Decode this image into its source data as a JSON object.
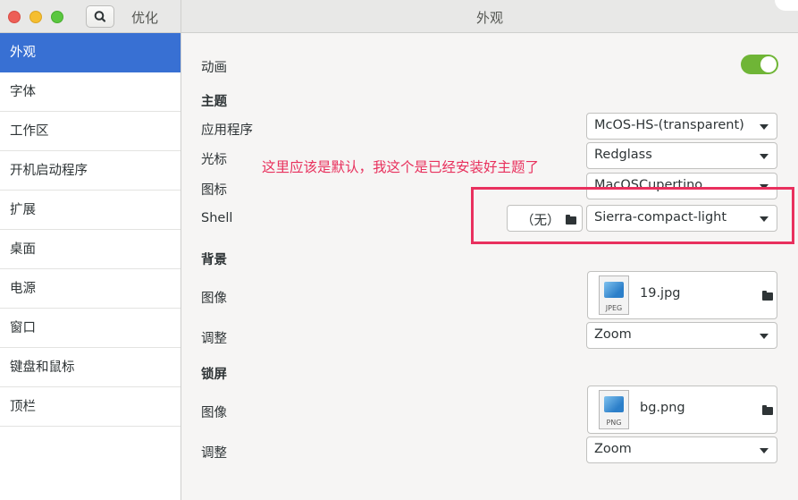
{
  "window": {
    "app_title": "优化",
    "page_title": "外观"
  },
  "sidebar": {
    "items": [
      {
        "label": "外观",
        "selected": true
      },
      {
        "label": "字体"
      },
      {
        "label": "工作区"
      },
      {
        "label": "开机启动程序"
      },
      {
        "label": "扩展"
      },
      {
        "label": "桌面"
      },
      {
        "label": "电源"
      },
      {
        "label": "窗口"
      },
      {
        "label": "键盘和鼠标"
      },
      {
        "label": "顶栏"
      }
    ]
  },
  "main": {
    "animation": {
      "label": "动画",
      "enabled": true
    },
    "themes": {
      "header": "主题",
      "applications": {
        "label": "应用程序",
        "value": "McOS-HS-(transparent)"
      },
      "cursor": {
        "label": "光标",
        "value": "Redglass"
      },
      "icons": {
        "label": "图标",
        "value": "MacOSCupertino"
      },
      "shell": {
        "label": "Shell",
        "file_value": "（无）",
        "value": "Sierra-compact-light"
      }
    },
    "background": {
      "header": "背景",
      "image": {
        "label": "图像",
        "filename": "19.jpg",
        "format": "JPEG"
      },
      "adjust": {
        "label": "调整",
        "value": "Zoom"
      }
    },
    "lockscreen": {
      "header": "锁屏",
      "image": {
        "label": "图像",
        "filename": "bg.png",
        "format": "PNG"
      },
      "adjust": {
        "label": "调整",
        "value": "Zoom"
      }
    }
  },
  "annotation": {
    "text": "这里应该是默认，我这个是已经安装好主题了",
    "color": "#e9305e"
  },
  "colors": {
    "selection": "#3870d3",
    "toggle_on": "#6fb536"
  },
  "icons": [
    "search-icon",
    "folder-icon",
    "chevron-down-icon",
    "image-file-icon"
  ]
}
